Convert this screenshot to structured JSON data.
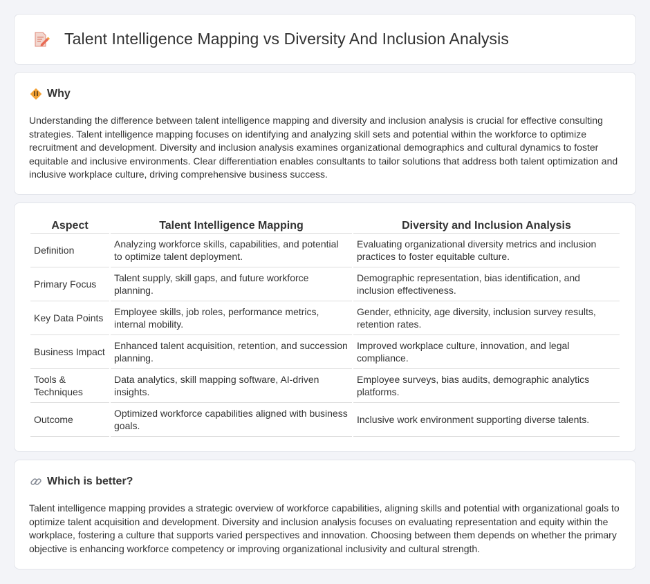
{
  "header": {
    "title": "Talent Intelligence Mapping vs Diversity And Inclusion Analysis",
    "icon": "document-pencil-icon"
  },
  "why": {
    "icon": "diamond-sign-icon",
    "title": "Why",
    "body": "Understanding the difference between talent intelligence mapping and diversity and inclusion analysis is crucial for effective consulting strategies. Talent intelligence mapping focuses on identifying and analyzing skill sets and potential within the workforce to optimize recruitment and development. Diversity and inclusion analysis examines organizational demographics and cultural dynamics to foster equitable and inclusive environments. Clear differentiation enables consultants to tailor solutions that address both talent optimization and inclusive workplace culture, driving comprehensive business success."
  },
  "comparison": {
    "headers": [
      "Aspect",
      "Talent Intelligence Mapping",
      "Diversity and Inclusion Analysis"
    ],
    "rows": [
      [
        "Definition",
        "Analyzing workforce skills, capabilities, and potential to optimize talent deployment.",
        "Evaluating organizational diversity metrics and inclusion practices to foster equitable culture."
      ],
      [
        "Primary Focus",
        "Talent supply, skill gaps, and future workforce planning.",
        "Demographic representation, bias identification, and inclusion effectiveness."
      ],
      [
        "Key Data Points",
        "Employee skills, job roles, performance metrics, internal mobility.",
        "Gender, ethnicity, age diversity, inclusion survey results, retention rates."
      ],
      [
        "Business Impact",
        "Enhanced talent acquisition, retention, and succession planning.",
        "Improved workplace culture, innovation, and legal compliance."
      ],
      [
        "Tools & Techniques",
        "Data analytics, skill mapping software, AI-driven insights.",
        "Employee surveys, bias audits, demographic analytics platforms."
      ],
      [
        "Outcome",
        "Optimized workforce capabilities aligned with business goals.",
        "Inclusive work environment supporting diverse talents."
      ]
    ]
  },
  "better": {
    "icon": "link-icon",
    "title": "Which is better?",
    "body": "Talent intelligence mapping provides a strategic overview of workforce capabilities, aligning skills and potential with organizational goals to optimize talent acquisition and development. Diversity and inclusion analysis focuses on evaluating representation and equity within the workplace, fostering a culture that supports varied perspectives and innovation. Choosing between them depends on whether the primary objective is enhancing workforce competency or improving organizational inclusivity and cultural strength."
  },
  "colors": {
    "background": "#f3f4f8",
    "card": "#ffffff",
    "accent_orange": "#f4a235",
    "icon_pink": "#e8766a"
  }
}
